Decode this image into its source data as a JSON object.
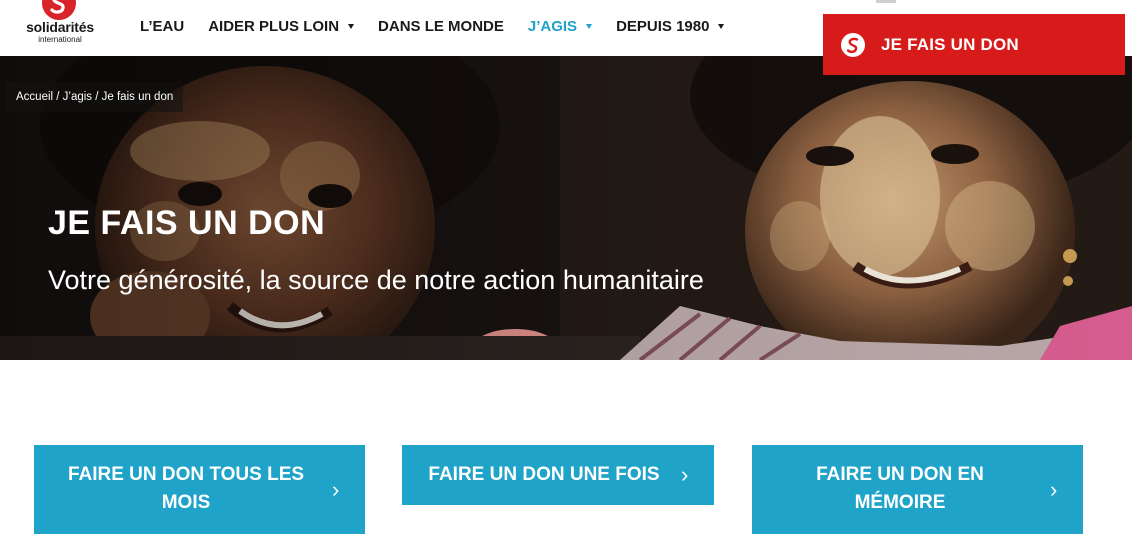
{
  "logo": {
    "name": "solidarités",
    "subtitle": "international",
    "icon": "solidarites-s-logo-icon"
  },
  "nav": {
    "items": [
      {
        "label": "L’EAU",
        "dropdown": false,
        "active": false
      },
      {
        "label": "AIDER PLUS LOIN",
        "dropdown": true,
        "active": false
      },
      {
        "label": "DANS LE MONDE",
        "dropdown": false,
        "active": false
      },
      {
        "label": "J’AGIS",
        "dropdown": true,
        "active": true
      },
      {
        "label": "DEPUIS 1980",
        "dropdown": true,
        "active": false
      }
    ]
  },
  "donate": {
    "label": "JE FAIS UN DON",
    "icon": "solidarites-s-logo-icon"
  },
  "breadcrumb": "Accueil / J’agis / Je fais un don",
  "hero": {
    "title": "JE FAIS UN DON",
    "subtitle": "Votre générosité, la source de notre action humanitaire"
  },
  "options": [
    {
      "line1": "FAIRE UN DON TOUS LES",
      "line2": "MOIS",
      "icon": "chevron-right-icon"
    },
    {
      "line1": "FAIRE UN DON UNE FOIS",
      "line2": "",
      "icon": "chevron-right-icon"
    },
    {
      "line1": "FAIRE UN DON EN",
      "line2": "MÉMOIRE",
      "icon": "chevron-right-icon"
    }
  ],
  "colors": {
    "brand_red": "#d71a1a",
    "accent_blue": "#1fa3c8",
    "text_dark": "#1a1a1a",
    "white": "#ffffff"
  }
}
